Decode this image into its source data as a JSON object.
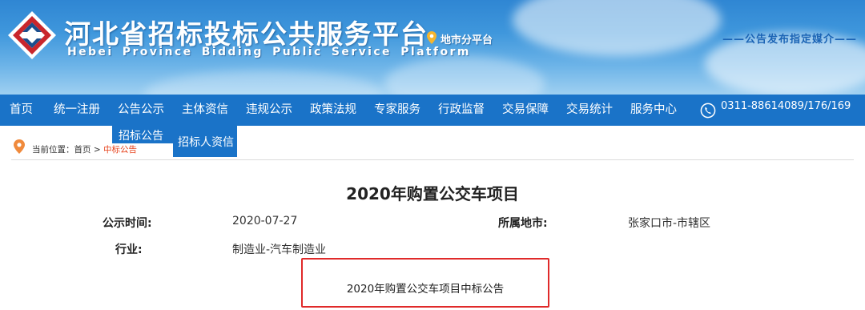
{
  "header": {
    "title": "河北省招标投标公共服务平台",
    "subtitle": "Hebei  Province  Bidding  Public  Service  Platform",
    "city_platform": "地市分平台",
    "media_notice": "——公告发布指定媒介——"
  },
  "nav": {
    "items": [
      "首页",
      "统一注册",
      "公告公示",
      "主体资信",
      "违规公示",
      "政策法规",
      "专家服务",
      "行政监督",
      "交易保障",
      "交易统计",
      "服务中心"
    ],
    "phone": "0311-88614089/176/169",
    "dropdown": [
      "招标公告",
      "招标人资信"
    ]
  },
  "breadcrumb": {
    "label": "当前位置：",
    "home": "首页",
    "sep": ">",
    "current": "中标公告"
  },
  "article": {
    "title": "2020年购置公交车项目",
    "fields": {
      "time_label": "公示时间:",
      "time_value": "2020-07-27",
      "city_label": "所属地市:",
      "city_value": "张家口市-市辖区",
      "industry_label": "行业:",
      "industry_value": "制造业-汽车制造业"
    },
    "notice": "2020年购置公交车项目中标公告"
  },
  "colors": {
    "nav_bg": "#1a73c8",
    "highlight": "#e02a2a",
    "breadcrumb_current": "#e7421b",
    "pin": "#f08a3c"
  }
}
